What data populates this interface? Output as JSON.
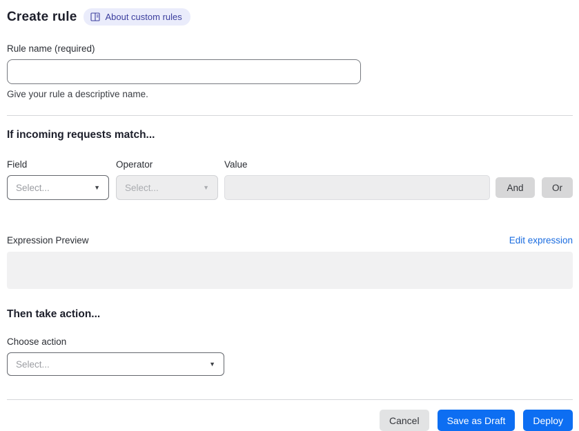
{
  "page": {
    "title": "Create rule"
  },
  "header": {
    "badge": {
      "label": "About custom rules"
    }
  },
  "rule_name": {
    "label": "Rule name (required)",
    "value": "",
    "placeholder": "",
    "helper": "Give your rule a descriptive name."
  },
  "match_section": {
    "heading": "If incoming requests match...",
    "field": {
      "label": "Field",
      "selected": "Select...",
      "disabled": false
    },
    "operator": {
      "label": "Operator",
      "selected": "Select...",
      "disabled": true
    },
    "value": {
      "label": "Value",
      "value": "",
      "disabled": true
    },
    "and_button": "And",
    "or_button": "Or"
  },
  "expression": {
    "label": "Expression Preview",
    "edit_link": "Edit expression",
    "content": ""
  },
  "action_section": {
    "heading": "Then take action...",
    "choose_label": "Choose action",
    "selected": "Select..."
  },
  "footer": {
    "cancel": "Cancel",
    "save_draft": "Save as Draft",
    "deploy": "Deploy"
  },
  "colors": {
    "accent_blue": "#0d6ef2",
    "link_blue": "#1a6ce0",
    "badge_bg": "#eaecfb",
    "badge_text": "#3c3f9e",
    "disabled_bg": "#ededee",
    "divider": "#d5d6d9"
  },
  "icons": {
    "caret": "▼"
  }
}
